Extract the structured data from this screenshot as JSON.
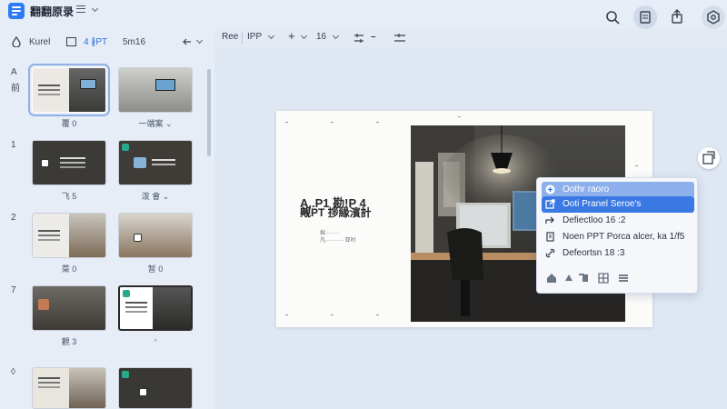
{
  "app": {
    "title": "翻翻原录"
  },
  "toolbar": {
    "icons": [
      "search-icon",
      "layout-icon",
      "share-icon",
      "settings-icon"
    ]
  },
  "sidebar": {
    "label_left": "Kurel",
    "label_mid": "4 ∦PT",
    "label_right": "5m16",
    "rows": [
      {
        "num": "A",
        "sub": "前",
        "caps": [
          "覆 0",
          "一端案 ⌄"
        ]
      },
      {
        "num": "1",
        "caps": [
          "飞 5",
          "泼 會 ⌄"
        ]
      },
      {
        "num": "2",
        "caps": [
          "菜 0",
          "暂 0"
        ]
      },
      {
        "num": "7",
        "caps": [
          "觀 3",
          "◦"
        ]
      },
      {
        "num": "◊",
        "caps": []
      }
    ]
  },
  "format": {
    "font": "Ree",
    "style": "IPP",
    "plus": "+",
    "size": "16"
  },
  "slide": {
    "title": "A,.P1 勘!P 4",
    "subtitle": "觍PT 拶緣濱計",
    "notes": [
      "拙 ·······",
      "凡·········· 亚吋"
    ]
  },
  "menu": {
    "items": [
      {
        "label": "Oothr raoro",
        "icon": "plus-circle-icon"
      },
      {
        "label": "Ooti Pranel Seroe's",
        "icon": "external-icon"
      },
      {
        "label": "Defiectloo 16 :2",
        "icon": "redirect-icon"
      },
      {
        "label": "Noen PPT Porca alcer, ka 1/f5",
        "icon": "document-icon"
      },
      {
        "label": "Defeortsn 18 :3",
        "icon": "link-icon"
      }
    ],
    "footer_icons": [
      "home-icon",
      "bell-icon",
      "format-icon",
      "grid-icon",
      "menu-icon"
    ]
  },
  "colors": {
    "accent": "#3a78e3",
    "accent_light": "#8db0ec",
    "logo": "#2f7bf5",
    "badge": "#28a98b"
  }
}
